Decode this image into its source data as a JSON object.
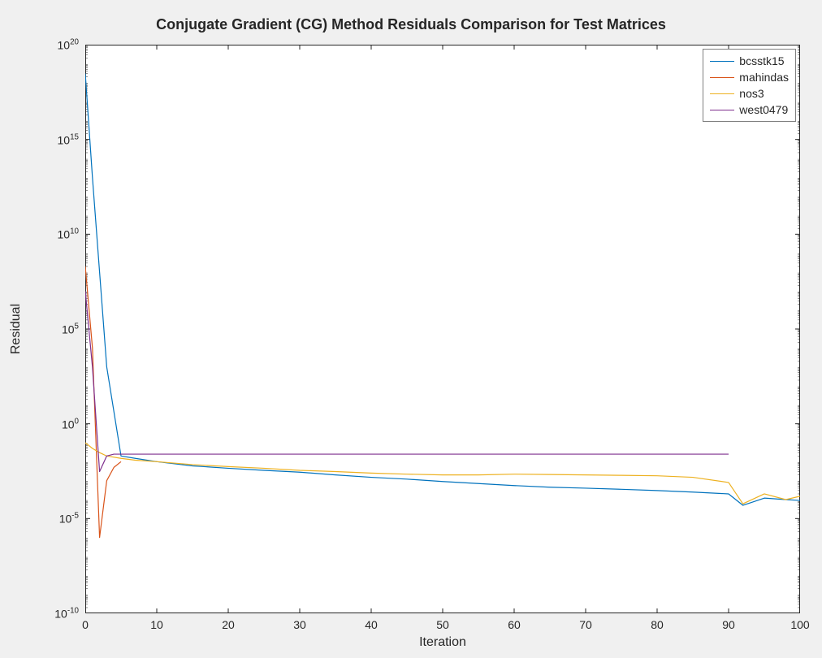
{
  "chart_data": {
    "type": "line",
    "title": "Conjugate Gradient (CG) Method Residuals Comparison for Test Matrices",
    "xlabel": "Iteration",
    "ylabel": "Residual",
    "xlim": [
      0,
      100
    ],
    "ylim_log10": [
      -10,
      20
    ],
    "ylog": true,
    "y_ticks_log10": [
      -10,
      -5,
      0,
      5,
      10,
      15,
      20
    ],
    "x_ticks": [
      0,
      10,
      20,
      30,
      40,
      50,
      60,
      70,
      80,
      90,
      100
    ],
    "legend_position": "northeast",
    "series": [
      {
        "name": "bcsstk15",
        "color": "#0072BD",
        "x": [
          0,
          1,
          2,
          3,
          5,
          7,
          10,
          15,
          20,
          25,
          30,
          35,
          40,
          45,
          50,
          55,
          60,
          65,
          70,
          75,
          80,
          85,
          90,
          92,
          95,
          98,
          100
        ],
        "y": [
          3e+18,
          10000000000000.0,
          100000000.0,
          1000.0,
          0.02,
          0.015,
          0.01,
          0.006,
          0.0045,
          0.0035,
          0.0028,
          0.002,
          0.0015,
          0.0012,
          0.0009,
          0.0007,
          0.00055,
          0.00045,
          0.0004,
          0.00035,
          0.0003,
          0.00025,
          0.0002,
          5e-05,
          0.00012,
          0.0001,
          9e-05
        ]
      },
      {
        "name": "mahindas",
        "color": "#D95319",
        "x": [
          0,
          1,
          2,
          3,
          4,
          5
        ],
        "y": [
          200000000.0,
          10000.0,
          1e-06,
          0.001,
          0.005,
          0.01
        ]
      },
      {
        "name": "nos3",
        "color": "#EDB120",
        "x": [
          0,
          1,
          2,
          3,
          5,
          7,
          10,
          15,
          20,
          25,
          30,
          35,
          40,
          45,
          50,
          55,
          60,
          65,
          70,
          75,
          80,
          85,
          90,
          92,
          95,
          98,
          100
        ],
        "y": [
          0.1,
          0.05,
          0.03,
          0.02,
          0.015,
          0.012,
          0.01,
          0.007,
          0.0055,
          0.0045,
          0.0035,
          0.003,
          0.0025,
          0.0022,
          0.002,
          0.002,
          0.0022,
          0.0021,
          0.002,
          0.0019,
          0.0018,
          0.0015,
          0.0008,
          6e-05,
          0.0002,
          0.0001,
          0.00015
        ]
      },
      {
        "name": "west0479",
        "color": "#7E2F8E",
        "x": [
          0,
          1,
          2,
          3,
          4,
          5,
          10,
          20,
          40,
          60,
          80,
          90
        ],
        "y": [
          10000000.0,
          1000.0,
          0.003,
          0.02,
          0.025,
          0.025,
          0.025,
          0.025,
          0.025,
          0.025,
          0.025,
          0.025
        ]
      }
    ]
  }
}
